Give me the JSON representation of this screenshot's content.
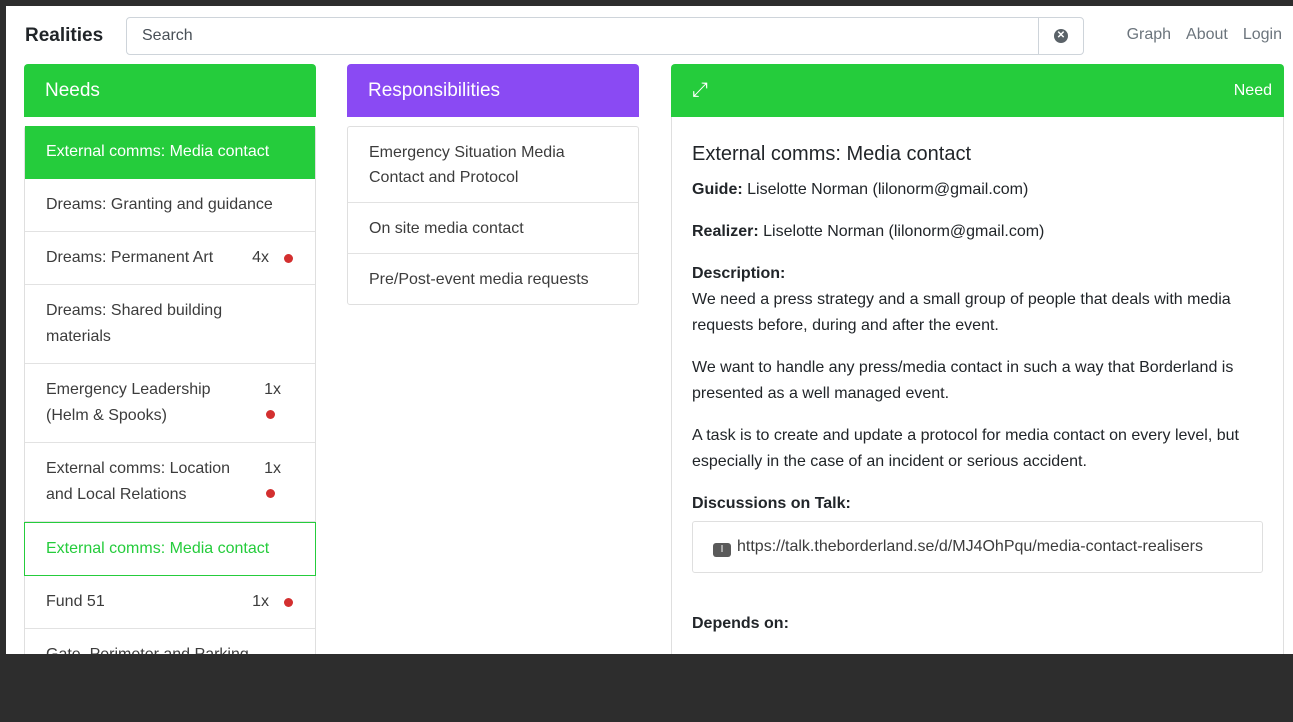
{
  "nav": {
    "brand": "Realities",
    "search_placeholder": "Search",
    "links": [
      "Graph",
      "About",
      "Login"
    ]
  },
  "needs": {
    "title": "Needs",
    "items": [
      {
        "label": "External comms: Media contact",
        "count": "",
        "dot": false,
        "state": "active"
      },
      {
        "label": "Dreams: Granting and guidance",
        "count": "",
        "dot": false,
        "state": ""
      },
      {
        "label": "Dreams: Permanent Art",
        "count": "4x",
        "dot": true,
        "state": ""
      },
      {
        "label": "Dreams: Shared building materials",
        "count": "",
        "dot": false,
        "state": ""
      },
      {
        "label": "Emergency Leadership (Helm & Spooks)",
        "count": "1x",
        "dot": true,
        "state": ""
      },
      {
        "label": "External comms: Location and Local Relations",
        "count": "1x",
        "dot": true,
        "state": ""
      },
      {
        "label": "External comms: Media contact",
        "count": "",
        "dot": false,
        "state": "selected"
      },
      {
        "label": "Fund 51",
        "count": "1x",
        "dot": true,
        "state": ""
      },
      {
        "label": "Gate, Perimeter and Parking",
        "count": "",
        "dot": false,
        "state": ""
      }
    ]
  },
  "responsibilities": {
    "title": "Responsibilities",
    "items": [
      "Emergency Situation Media Contact and Protocol",
      "On site media contact",
      "Pre/Post-event media requests"
    ]
  },
  "detail": {
    "type_label": "Need",
    "title": "External comms: Media contact",
    "guide_label": "Guide:",
    "guide_value": "Liselotte Norman (lilonorm@gmail.com)",
    "realizer_label": "Realizer:",
    "realizer_value": "Liselotte Norman (lilonorm@gmail.com)",
    "description_label": "Description:",
    "description": [
      "We need a press strategy and a small group of people that deals with media requests before, during and after the event.",
      "We want to handle any press/media contact in such a way that Borderland is presented as a well managed event.",
      "A task is to create and update a protocol for media contact on every level, but especially in the case of an incident or serious accident."
    ],
    "discussions_label": "Discussions on Talk:",
    "talk_url": "https://talk.theborderland.se/d/MJ4OhPqu/media-contact-realisers",
    "depends_label": "Depends on:"
  },
  "colors": {
    "need_green": "#25cc3c",
    "responsibility_purple": "#8a4af3",
    "alert_dot": "#d32f2f"
  }
}
